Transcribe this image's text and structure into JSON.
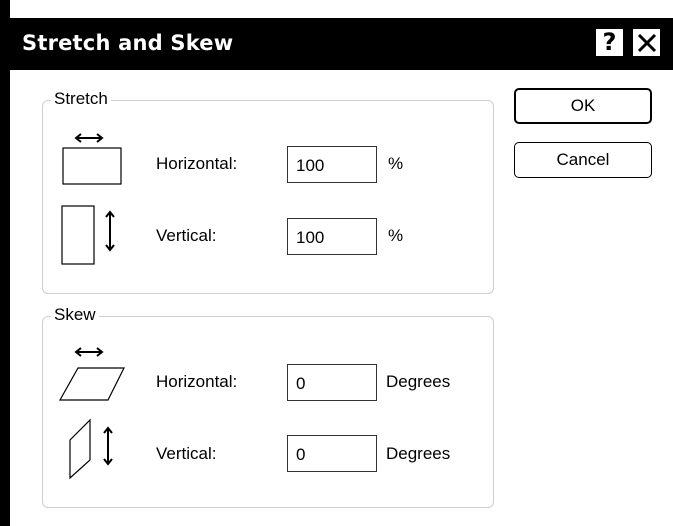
{
  "window": {
    "title": "Stretch and Skew",
    "help_glyph": "?",
    "close_icon": "close-icon"
  },
  "stretch": {
    "legend": "Stretch",
    "horizontal": {
      "label": "Horizontal:",
      "value": "100",
      "unit": "%",
      "icon": "stretch-horizontal-icon"
    },
    "vertical": {
      "label": "Vertical:",
      "value": "100",
      "unit": "%",
      "icon": "stretch-vertical-icon"
    }
  },
  "skew": {
    "legend": "Skew",
    "horizontal": {
      "label": "Horizontal:",
      "value": "0",
      "unit": "Degrees",
      "icon": "skew-horizontal-icon"
    },
    "vertical": {
      "label": "Vertical:",
      "value": "0",
      "unit": "Degrees",
      "icon": "skew-vertical-icon"
    }
  },
  "buttons": {
    "ok": "OK",
    "cancel": "Cancel"
  }
}
